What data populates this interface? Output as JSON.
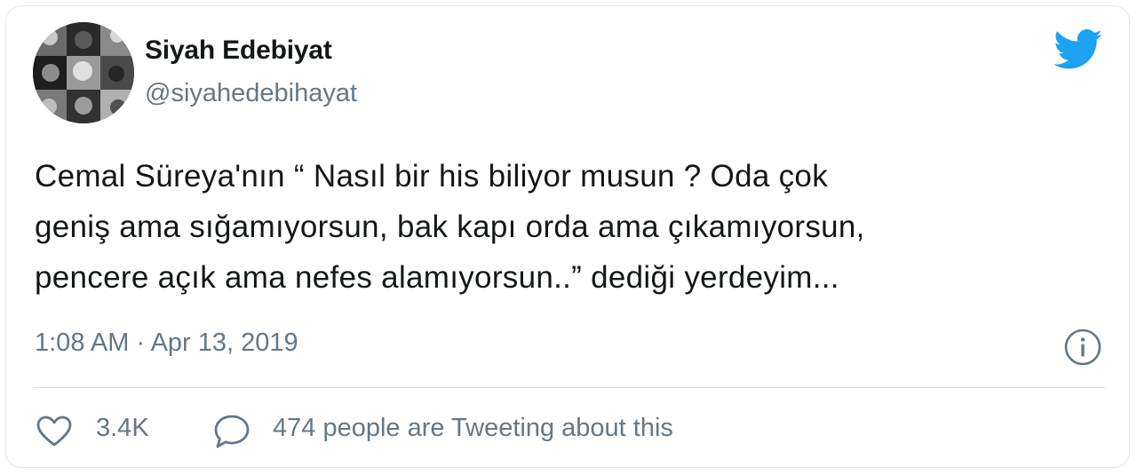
{
  "user": {
    "display_name": "Siyah Edebiyat",
    "handle": "@siyahedebihayat",
    "avatar_icon": "collage-avatar"
  },
  "brand": {
    "icon": "twitter-bird-icon",
    "color": "#1da1f2"
  },
  "tweet": {
    "text": "Cemal Süreya'nın “ Nasıl bir his biliyor musun ? Oda çok\ngeniş ama sığamıyorsun, bak kapı orda ama çıkamıyorsun,\npencere açık ama nefes alamıyorsun..” dediği yerdeyim...",
    "timestamp": "1:08 AM · Apr 13, 2019"
  },
  "actions": {
    "like_icon": "heart-icon",
    "like_count": "3.4K",
    "reply_icon": "speech-bubble-icon",
    "discussion_text": "474 people are Tweeting about this",
    "info_icon": "info-icon"
  },
  "colors": {
    "text_primary": "#14171a",
    "text_secondary": "#657786",
    "border": "#e1e8ed"
  }
}
